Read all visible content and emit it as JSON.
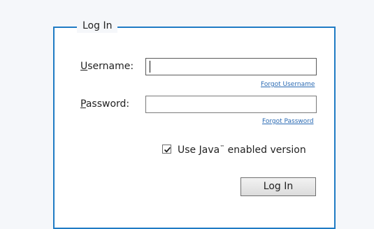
{
  "login_box": {
    "legend": "Log In",
    "frame_color": "#1f7bc4"
  },
  "username": {
    "label_mnemonic": "U",
    "label_rest": "sername:",
    "value": "",
    "forgot_link": "Forgot Username"
  },
  "password": {
    "label_mnemonic": "P",
    "label_rest": "assword:",
    "value": "",
    "forgot_link": "Forgot Password"
  },
  "java_option": {
    "checked": true,
    "label_before": "Use ",
    "label_mnemonic": "J",
    "label_middle": "ava",
    "trademark": "™",
    "label_after": " enabled version"
  },
  "submit": {
    "label": "Log In"
  },
  "icons": {
    "checkbox_mark": "check-icon"
  },
  "colors": {
    "link": "#2a6ab3",
    "background": "#f5f7fa"
  }
}
